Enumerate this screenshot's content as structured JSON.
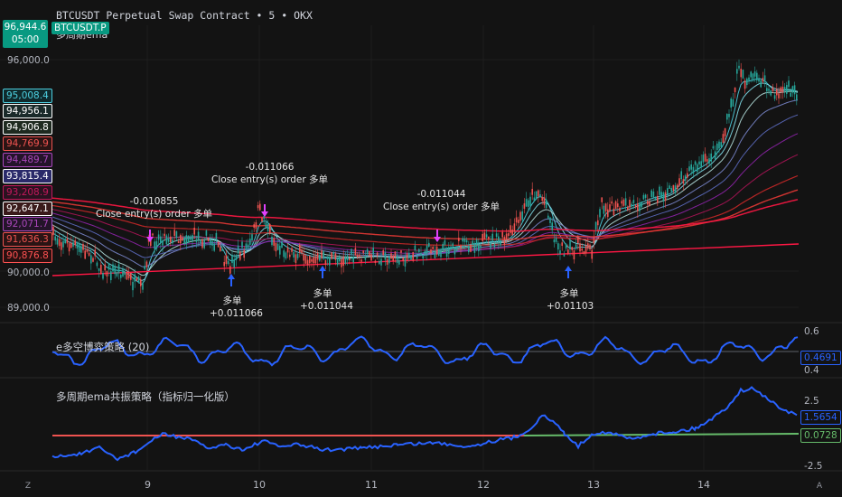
{
  "header": {
    "title": "BTCUSDT Perpetual Swap Contract • 5 • OKX",
    "indicator_label": "多周期ema",
    "price_badge": {
      "price": "96,944.6",
      "countdown": "05:00",
      "color": "#089981"
    },
    "symbol_badge": "BTCUSDT.P"
  },
  "price_axis": {
    "ticks": [
      "96,000.0",
      "90,000.0",
      "89,000.0"
    ]
  },
  "ema_tags": [
    {
      "value": "95,008.4",
      "color": "#4dd0e1",
      "bg": "#0f2a2d"
    },
    {
      "value": "94,956.1",
      "color": "#ffffff",
      "bg": "#1a2a2a"
    },
    {
      "value": "94,906.8",
      "color": "#ffffff",
      "bg": "#1e2a20"
    },
    {
      "value": "94,769.9",
      "color": "#ef5350",
      "bg": "#2a1414"
    },
    {
      "value": "94,489.7",
      "color": "#ab47bc",
      "bg": "#24142a"
    },
    {
      "value": "93,815.4",
      "color": "#ffffff",
      "bg": "#2a2a6a"
    },
    {
      "value": "93,208.9",
      "color": "#c2185b",
      "bg": "#2a1220"
    },
    {
      "value": "92,647.1",
      "color": "#ffffff",
      "bg": "#3a1a1a"
    },
    {
      "value": "92,071.7",
      "color": "#ab47bc",
      "bg": "#24142a"
    },
    {
      "value": "91,636.3",
      "color": "#ef5350",
      "bg": "#2a1414"
    },
    {
      "value": "90,876.8",
      "color": "#ff5252",
      "bg": "#2a1010"
    }
  ],
  "trades": [
    {
      "kind": "close",
      "pnl": "-0.010855",
      "label": "Close entry(s) order 多单"
    },
    {
      "kind": "close",
      "pnl": "-0.011066",
      "label": "Close entry(s) order 多单"
    },
    {
      "kind": "close",
      "pnl": "-0.011044",
      "label": "Close entry(s) order 多单"
    },
    {
      "kind": "entry",
      "label": "多单",
      "pnl": "+0.011066"
    },
    {
      "kind": "entry",
      "label": "多单",
      "pnl": "+0.011044"
    },
    {
      "kind": "entry",
      "label": "多单",
      "pnl": "+0.01103"
    }
  ],
  "pane2": {
    "title": "e多空博弈策略 (20)",
    "ticks": [
      "0.6",
      "0.4"
    ],
    "value_tag": "0.4691",
    "line_color": "#2962ff"
  },
  "pane3": {
    "title": "多周期ema共振策略（指标归一化版）",
    "ticks": [
      "2.5",
      "-2.5"
    ],
    "value_tag_blue": "1.5654",
    "value_tag_green": "0.0728",
    "colors": {
      "blue": "#2962ff",
      "green": "#66bb6a",
      "red": "#ef5350"
    }
  },
  "time_axis": {
    "labels": [
      "9",
      "10",
      "11",
      "12",
      "13",
      "14"
    ]
  },
  "corner_buttons": {
    "left": "Z",
    "right": "A"
  },
  "colors": {
    "background": "#131313",
    "bull": "#26a69a",
    "bear": "#ef5350",
    "entry_arrow": "#2962ff",
    "exit_arrow": "#e040fb"
  }
}
